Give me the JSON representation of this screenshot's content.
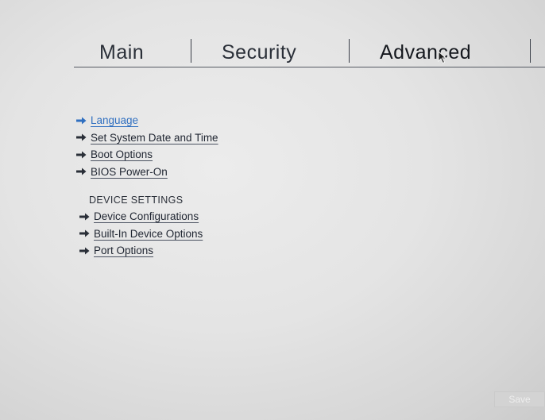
{
  "tabs": {
    "main": "Main",
    "security": "Security",
    "advanced": "Advanced"
  },
  "menu": {
    "items": [
      {
        "label": "Language",
        "selected": true
      },
      {
        "label": "Set System Date and Time"
      },
      {
        "label": "Boot Options"
      },
      {
        "label": "BIOS Power-On"
      }
    ]
  },
  "device_settings": {
    "heading": "DEVICE SETTINGS",
    "items": [
      {
        "label": "Device Configurations"
      },
      {
        "label": "Built-In Device Options"
      },
      {
        "label": "Port Options"
      }
    ]
  },
  "footer": {
    "save_label": "Save"
  },
  "colors": {
    "selected_item": "#2f6fc0",
    "text": "#1f2531",
    "background": "#e4e4e4"
  },
  "icons": {
    "menu_arrow": "arrow-right-icon",
    "pointer": "mouse-pointer-icon"
  }
}
